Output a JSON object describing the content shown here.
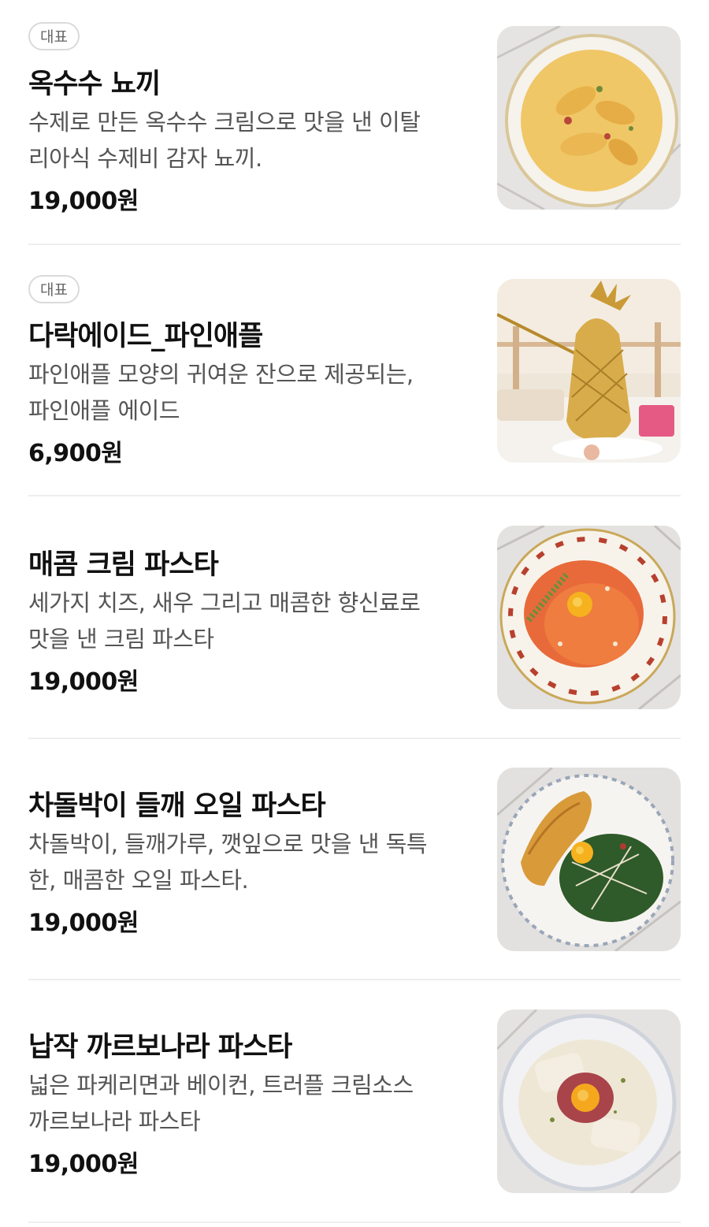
{
  "menu": {
    "items": [
      {
        "badge": "대표",
        "name": "옥수수 뇨끼",
        "description": "수제로 만든 옥수수 크림으로 맛을 낸 이탈리아식 수제비 감자 뇨끼.",
        "desc_lines": [
          "수제로 만든 옥수수 크림으로 맛을 낸 이탈",
          "리아식 수제비 감자 뇨끼."
        ],
        "price": "19,000원",
        "image": "corn-gnocchi-photo"
      },
      {
        "badge": "대표",
        "name": "다락에이드_파인애플",
        "description": "파인애플 모양의 귀여운 잔으로 제공되는, 파인애플 에이드",
        "desc_lines": [
          "파인애플 모양의 귀여운 잔으로 제공되는,",
          "파인애플 에이드"
        ],
        "price": "6,900원",
        "image": "pineapple-ade-photo"
      },
      {
        "name": "매콤 크림 파스타",
        "description": "세가지 치즈, 새우 그리고 매콤한 향신료로 맛을 낸 크림 파스타",
        "desc_lines": [
          "세가지 치즈, 새우 그리고 매콤한 향신료로",
          "맛을 낸 크림 파스타"
        ],
        "price": "19,000원",
        "image": "spicy-cream-pasta-photo"
      },
      {
        "name": "차돌박이 들깨 오일 파스타",
        "description": "차돌박이, 들깨가루, 깻잎으로 맛을 낸 독특한, 매콤한 오일 파스타.",
        "desc_lines": [
          "차돌박이, 들깨가루, 깻잎으로 맛을 낸 독특",
          "한, 매콤한 오일 파스타."
        ],
        "price": "19,000원",
        "image": "brisket-perilla-oil-pasta-photo"
      },
      {
        "name": "납작 까르보나라 파스타",
        "description": "넓은 파케리면과 베이컨, 트러플 크림소스 까르보나라 파스타",
        "desc_lines": [
          "넓은 파케리면과 베이컨, 트러플 크림소스",
          "까르보나라 파스타"
        ],
        "price": "19,000원",
        "image": "flat-carbonara-pasta-photo"
      }
    ]
  },
  "colors": {
    "text_primary": "#111111",
    "text_secondary": "#555555",
    "badge_border": "#dadada",
    "divider": "#eeeeee"
  }
}
